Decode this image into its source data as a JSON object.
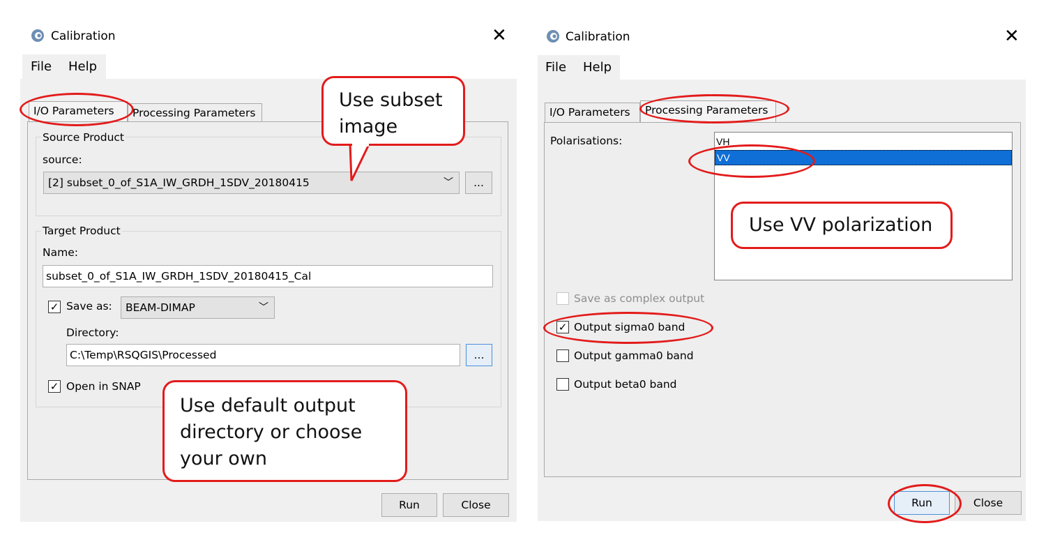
{
  "left_dialog": {
    "title": "Calibration",
    "close_glyph": "✕",
    "menu": [
      "File",
      "Help"
    ],
    "tabs": [
      "I/O Parameters",
      "Processing Parameters"
    ],
    "source_product": {
      "group_label": "Source Product",
      "source_label": "source:",
      "source_value": "[2] subset_0_of_S1A_IW_GRDH_1SDV_20180415",
      "browse_label": "..."
    },
    "target_product": {
      "group_label": "Target Product",
      "name_label": "Name:",
      "name_value": "subset_0_of_S1A_IW_GRDH_1SDV_20180415_Cal",
      "save_as_label": "Save as:",
      "save_as_checked": true,
      "format_value": "BEAM-DIMAP",
      "directory_label": "Directory:",
      "directory_value": "C:\\Temp\\RSQGIS\\Processed",
      "browse_label": "...",
      "open_in_snap_label": "Open in SNAP",
      "open_in_snap_checked": true
    },
    "buttons": {
      "run": "Run",
      "close": "Close"
    }
  },
  "right_dialog": {
    "title": "Calibration",
    "close_glyph": "✕",
    "menu": [
      "File",
      "Help"
    ],
    "tabs": [
      "I/O Parameters",
      "Processing Parameters"
    ],
    "polarisations_label": "Polarisations:",
    "polarisations": [
      {
        "label": "VH",
        "selected": false
      },
      {
        "label": "VV",
        "selected": true
      }
    ],
    "options": [
      {
        "label": "Save as complex output",
        "checked": false,
        "enabled": false
      },
      {
        "label": "Output sigma0 band",
        "checked": true,
        "enabled": true
      },
      {
        "label": "Output gamma0 band",
        "checked": false,
        "enabled": true
      },
      {
        "label": "Output beta0 band",
        "checked": false,
        "enabled": true
      }
    ],
    "buttons": {
      "run": "Run",
      "close": "Close"
    }
  },
  "annotations": {
    "subset_note": [
      "Use subset",
      "image"
    ],
    "directory_note": [
      "Use default output",
      "directory or choose",
      "your own"
    ],
    "polarization_note": "Use VV polarization"
  },
  "colors": {
    "annotation_red": "#e31b1b",
    "selection_blue": "#0f6fd6",
    "panel_gray": "#f0f0f0"
  },
  "icons": {
    "app": "esa-logo-icon",
    "check": "✓",
    "dropdown": "chevron-down-icon"
  }
}
